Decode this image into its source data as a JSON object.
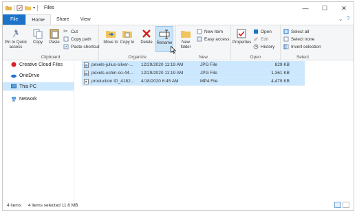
{
  "window": {
    "title": "Files",
    "controls": {
      "minimize": "—",
      "maximize": "☐",
      "close": "✕"
    }
  },
  "tabs": [
    {
      "label": "File"
    },
    {
      "label": "Home"
    },
    {
      "label": "Share"
    },
    {
      "label": "View"
    }
  ],
  "ribbon": {
    "clipboard": {
      "label": "Clipboard",
      "pin": "Pin to Quick access",
      "copy": "Copy",
      "paste": "Paste",
      "cut": "Cut",
      "copy_path": "Copy path",
      "paste_shortcut": "Paste shortcut"
    },
    "organize": {
      "label": "Organize",
      "move_to": "Move to",
      "copy_to": "Copy to",
      "delete": "Delete",
      "rename": "Rename"
    },
    "new": {
      "label": "New",
      "new_folder": "New folder",
      "new_item": "New item",
      "easy_access": "Easy access"
    },
    "open": {
      "label": "Open",
      "properties": "Properties",
      "open": "Open",
      "edit": "Edit",
      "history": "History"
    },
    "select": {
      "label": "Select",
      "select_all": "Select all",
      "select_none": "Select none",
      "invert": "Invert selection"
    }
  },
  "nav": {
    "items": [
      {
        "label": "Creative Cloud Files"
      },
      {
        "label": "OneDrive"
      },
      {
        "label": "This PC"
      },
      {
        "label": "Network"
      }
    ]
  },
  "files": [
    {
      "name": "pexels-julius-silver-...",
      "date": "12/29/2020 11:19 AM",
      "type": "JPG File",
      "size": "829 KB"
    },
    {
      "name": "pexels-ushin-so-44...",
      "date": "12/29/2020 11:19 AM",
      "type": "JPG File",
      "size": "1,361 KB"
    },
    {
      "name": "production ID_4182...",
      "date": "4/18/2020 6:45 AM",
      "type": "MP4 File",
      "size": "4,479 KB"
    }
  ],
  "status": {
    "items": "4 items",
    "selected": "4 items selected  11.6 MB"
  },
  "colors": {
    "accent": "#1a73c8",
    "selection": "#cce8ff"
  }
}
